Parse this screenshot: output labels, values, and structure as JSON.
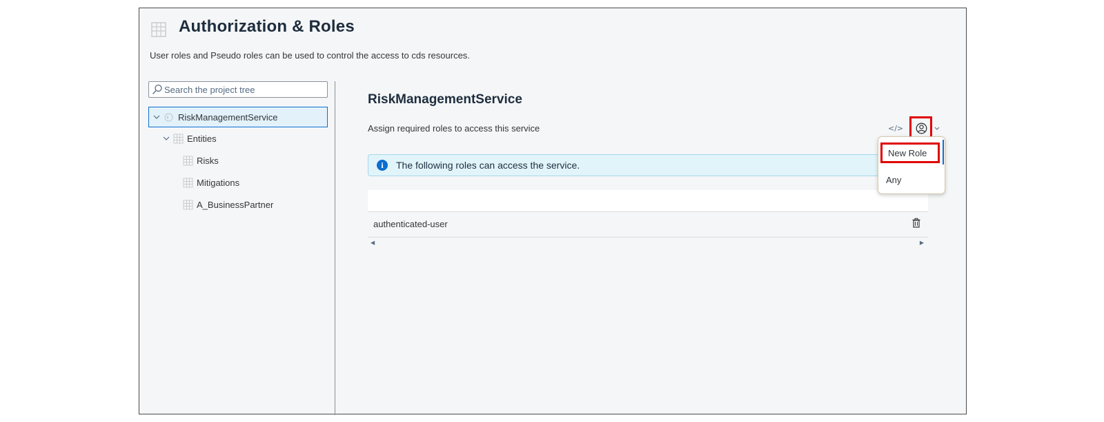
{
  "header": {
    "title": "Authorization & Roles",
    "subtitle": "User roles and Pseudo roles can be used to control the access to cds resources."
  },
  "search": {
    "placeholder": "Search the project tree"
  },
  "tree": {
    "service": "RiskManagementService",
    "entities_label": "Entities",
    "entities": [
      "Risks",
      "Mitigations",
      "A_BusinessPartner"
    ]
  },
  "detail": {
    "title": "RiskManagementService",
    "subtitle": "Assign required roles to access this service",
    "code_icon": "</>",
    "info_text": "The following roles can access the service.",
    "roles": [
      "authenticated-user"
    ]
  },
  "dropdown": {
    "items": [
      "New Role",
      "Any"
    ]
  },
  "colors": {
    "accent": "#0a6ed1",
    "highlight": "#e00000",
    "info_bg": "#e1f4fa"
  }
}
